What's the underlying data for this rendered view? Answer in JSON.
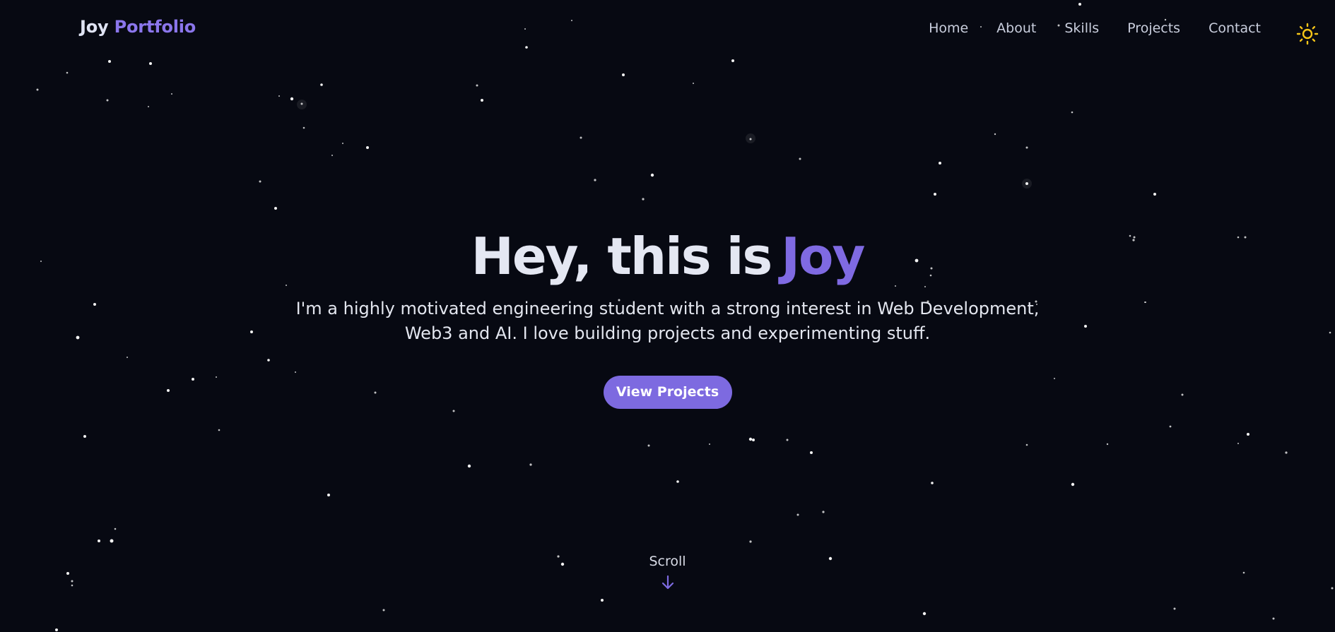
{
  "navbar": {
    "logo_first": "Joy",
    "logo_second": "Portfolio",
    "links": [
      "Home",
      "About",
      "Skills",
      "Projects",
      "Contact"
    ],
    "theme_icon": "sun-icon"
  },
  "hero": {
    "title_prefix": "Hey, this is",
    "title_name": "Joy",
    "description": "I'm a highly motivated engineering student with a strong interest in Web Development, Web3 and AI. I love building projects and experimenting stuff.",
    "cta_label": "View Projects"
  },
  "scroll": {
    "label": "Scroll",
    "icon": "arrow-down-icon"
  },
  "colors": {
    "background": "#070912",
    "accent": "#7d6ae0",
    "sun": "#f5c518"
  }
}
